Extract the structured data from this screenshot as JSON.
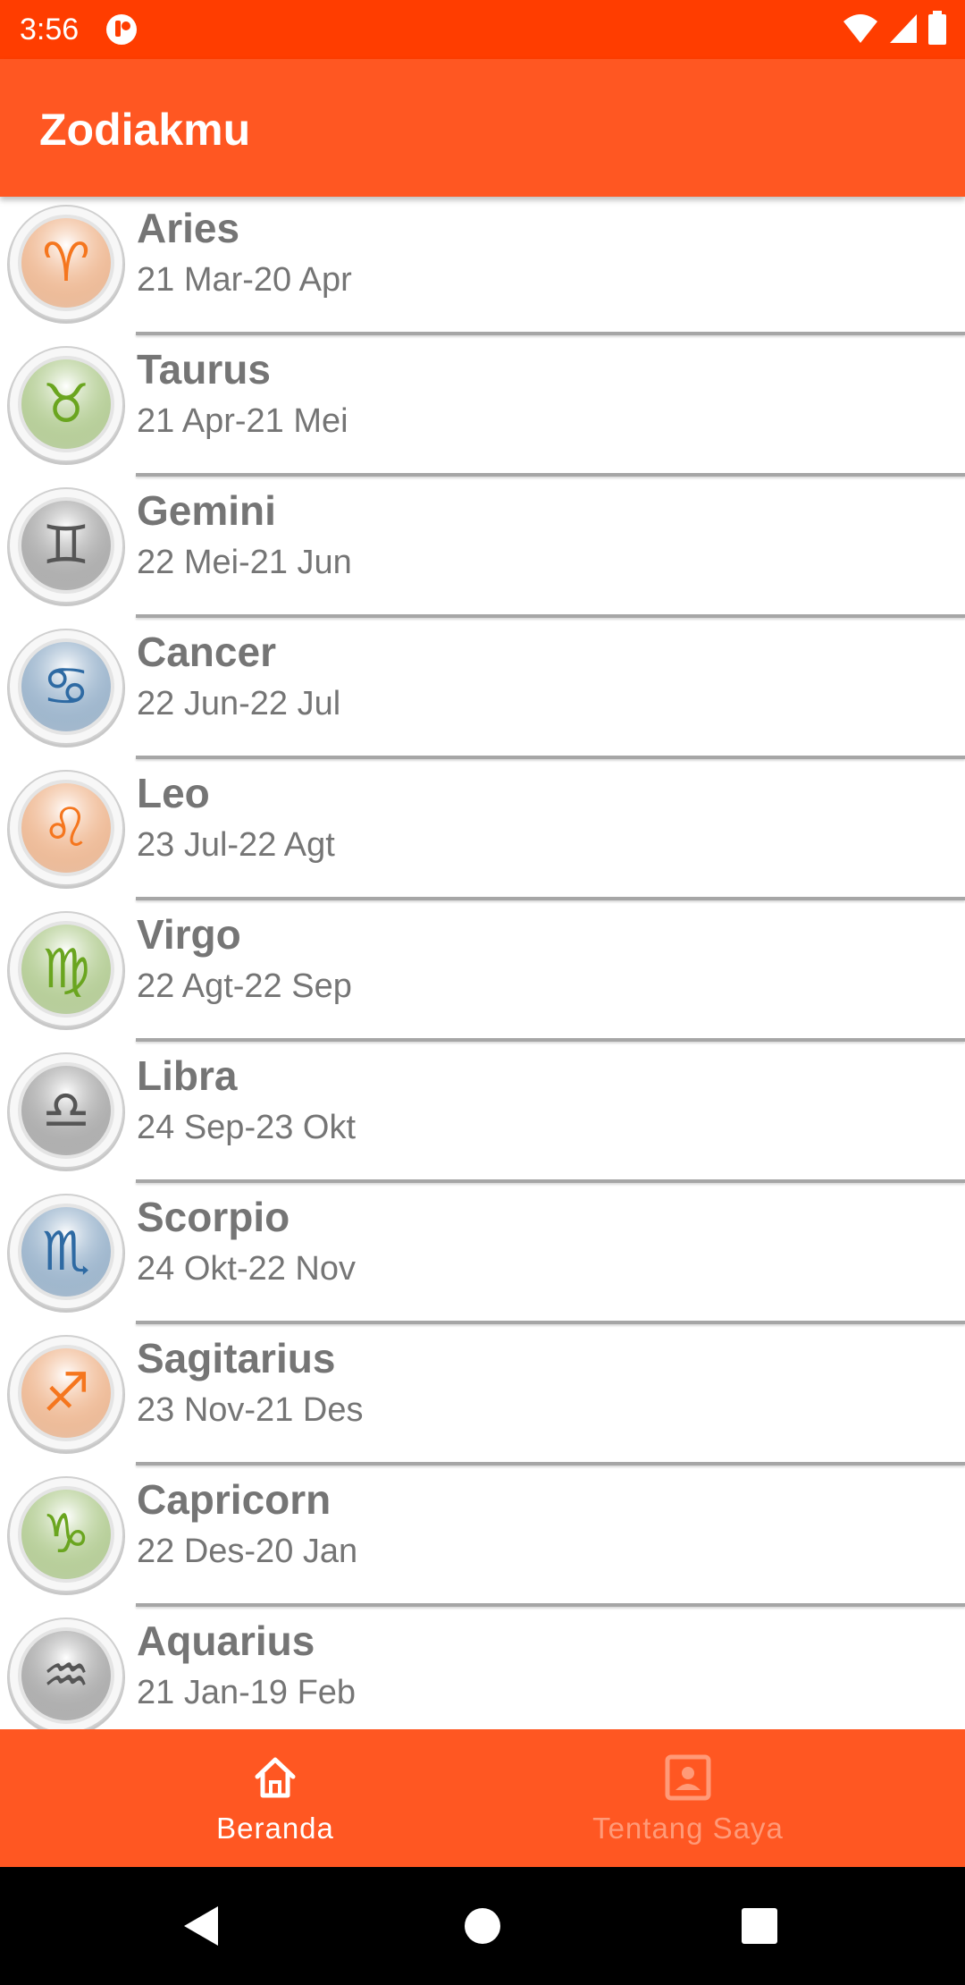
{
  "status_bar": {
    "time": "3:56"
  },
  "app_bar": {
    "title": "Zodiakmu"
  },
  "zodiacs": [
    {
      "name": "Aries",
      "dates": "21 Mar-20 Apr",
      "symbol": "♈",
      "color": "#f5761e"
    },
    {
      "name": "Taurus",
      "dates": "21 Apr-21 Mei",
      "symbol": "♉",
      "color": "#6aa51f"
    },
    {
      "name": "Gemini",
      "dates": "22 Mei-21 Jun",
      "symbol": "♊",
      "color": "#555555"
    },
    {
      "name": "Cancer",
      "dates": "22 Jun-22 Jul",
      "symbol": "♋",
      "color": "#2e6aa3"
    },
    {
      "name": "Leo",
      "dates": "23 Jul-22 Agt",
      "symbol": "♌",
      "color": "#f5761e"
    },
    {
      "name": "Virgo",
      "dates": "22 Agt-22 Sep",
      "symbol": "♍",
      "color": "#6aa51f"
    },
    {
      "name": "Libra",
      "dates": "24 Sep-23 Okt",
      "symbol": "♎",
      "color": "#555555"
    },
    {
      "name": "Scorpio",
      "dates": "24 Okt-22 Nov",
      "symbol": "♏",
      "color": "#2e6aa3"
    },
    {
      "name": "Sagitarius",
      "dates": "23 Nov-21 Des",
      "symbol": "♐",
      "color": "#f5761e"
    },
    {
      "name": "Capricorn",
      "dates": "22 Des-20 Jan",
      "symbol": "♑",
      "color": "#6aa51f"
    },
    {
      "name": "Aquarius",
      "dates": "21 Jan-19 Feb",
      "symbol": "♒",
      "color": "#555555"
    }
  ],
  "bottom_nav": {
    "home": {
      "label": "Beranda",
      "icon": "home-icon"
    },
    "about": {
      "label": "Tentang Saya",
      "icon": "account-box-icon"
    }
  },
  "colors": {
    "status_bar": "#ff3d00",
    "app_bar": "#ff5722",
    "text_gray": "#757575",
    "nav_inactive": "#ff9a78"
  }
}
